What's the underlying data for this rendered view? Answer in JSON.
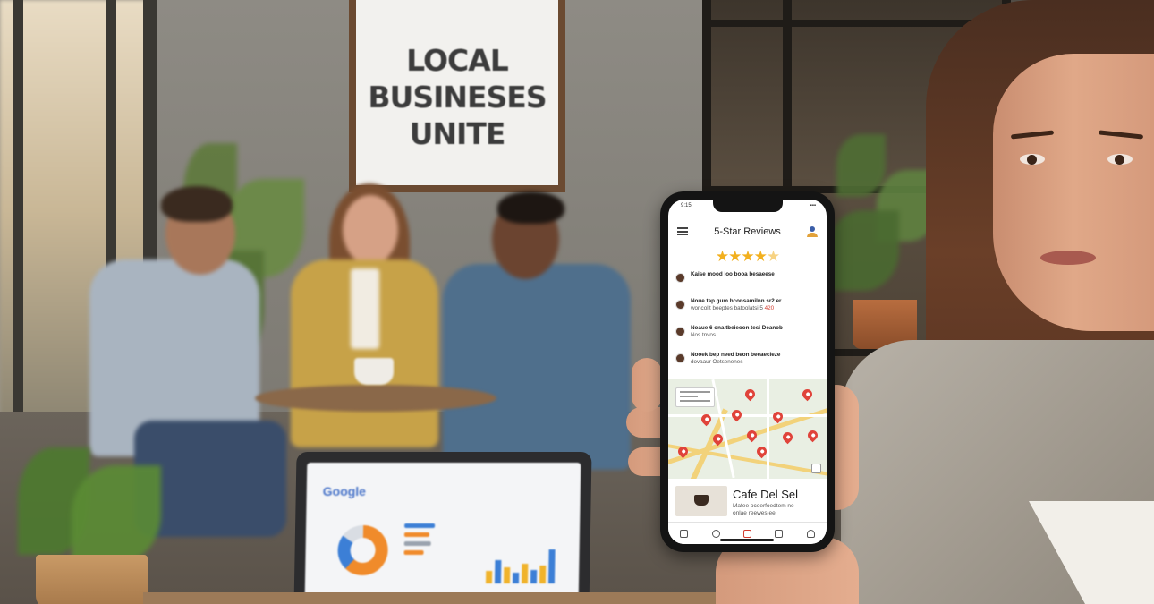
{
  "wall_sign": {
    "line1": "LOCAL",
    "line2": "BUSINESES",
    "line3": "UNITE"
  },
  "laptop": {
    "logo": "Google"
  },
  "phone": {
    "status_time": "9:15",
    "app_title": "5-Star Reviews",
    "stars": {
      "full": "★★★★",
      "half": "★"
    },
    "reviews": [
      {
        "line1": "Kaise mood loo booa besaeese",
        "line2": ""
      },
      {
        "line1": "Noue tap gum bconsamilnn sr2 er",
        "line2": "woncollt beeptes batoolatsi 5 ",
        "highlight": "420"
      },
      {
        "line1": "Noaue 6 ona tbeieoon tesi Deanob",
        "line2": "Nos tnvos"
      },
      {
        "line1": "Nooek bep need beon beeaecieze",
        "line2": "dovaaur Oetsenenes"
      }
    ],
    "card": {
      "title": "Cafe Del Sel",
      "subtitle": "Mafee ocoerfoedtem ne",
      "subtitle2": "onlae reewes ee"
    }
  },
  "colors": {
    "star": "#f2b01e",
    "pin": "#e0433a",
    "road": "#f2d27a"
  }
}
